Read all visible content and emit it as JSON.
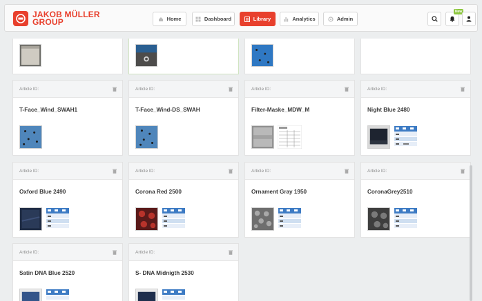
{
  "brand": {
    "line1": "JAKOB MÜLLER",
    "line2": "GROUP",
    "color": "#e8402d"
  },
  "nav": [
    {
      "label": "Home",
      "icon": "home-icon",
      "active": false
    },
    {
      "label": "Dashboard",
      "icon": "dashboard-icon",
      "active": false
    },
    {
      "label": "Library",
      "icon": "library-icon",
      "active": true
    },
    {
      "label": "Analytics",
      "icon": "analytics-icon",
      "active": false
    },
    {
      "label": "Admin",
      "icon": "admin-icon",
      "active": false
    }
  ],
  "header_actions": {
    "notification_badge": "New",
    "icons": [
      "search-icon",
      "bell-icon",
      "user-icon"
    ]
  },
  "article_id_label": "Article ID:",
  "cards": [
    {
      "title": "T-Face_Wind_SWAH1",
      "thumbnails": [
        "blue-fabric"
      ]
    },
    {
      "title": "T-Face_Wind-DS_SWAH",
      "thumbnails": [
        "blue-fabric"
      ]
    },
    {
      "title": "Filter-Maske_MDW_M",
      "thumbnails": [
        "gray-fabric",
        "spec-sheet"
      ]
    },
    {
      "title": "Night Blue 2480",
      "thumbnails": [
        "dark-fabric",
        "spec-sheet"
      ]
    },
    {
      "title": "Oxford Blue 2490",
      "thumbnails": [
        "dark-fabric",
        "spec-sheet"
      ]
    },
    {
      "title": "Corona Red 2500",
      "thumbnails": [
        "red-fabric",
        "spec-sheet"
      ]
    },
    {
      "title": "Ornament Gray 1950",
      "thumbnails": [
        "gray-fabric",
        "spec-sheet"
      ]
    },
    {
      "title": "CoronaGrey2510",
      "thumbnails": [
        "gray-fabric",
        "spec-sheet"
      ]
    },
    {
      "title": "Satin DNA Blue 2520",
      "thumbnails": [
        "blue-fabric",
        "spec-sheet"
      ]
    },
    {
      "title": "S- DNA Midnigth 2530",
      "thumbnails": [
        "blue-fabric",
        "spec-sheet"
      ]
    }
  ]
}
